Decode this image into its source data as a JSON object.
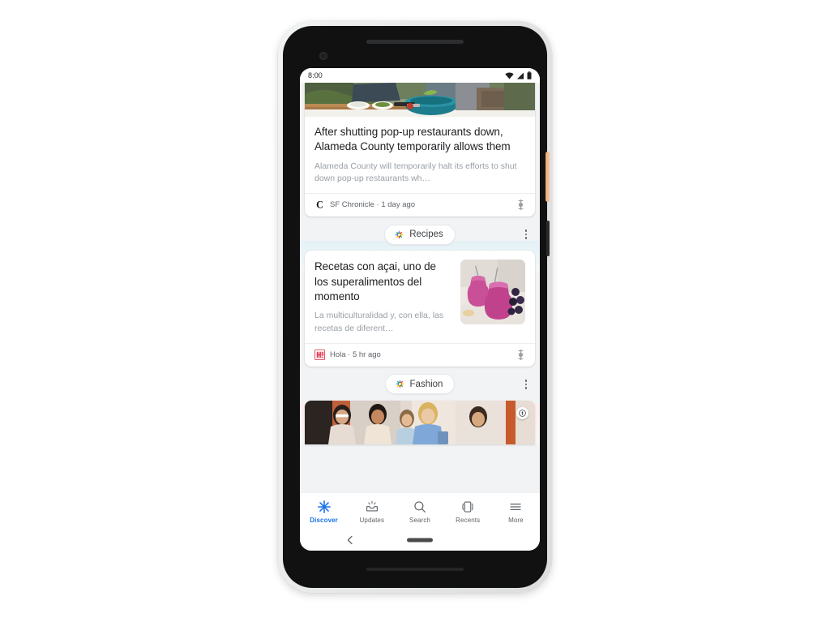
{
  "device": {
    "name": "pixel-phone",
    "power_button_color": "#e8a977",
    "frame_color": "#111112",
    "bezel_color": "#e9eaea"
  },
  "statusbar": {
    "time": "8:00",
    "icons": [
      "wifi-icon",
      "signal-icon",
      "battery-icon"
    ]
  },
  "feed": {
    "tint_blue": "#e4f1f6",
    "tint_pink": "#fdeef0",
    "accent_blue": "#1a73e8",
    "cards": [
      {
        "id": "news-card",
        "image_alt": "outdoor-cooking-scene",
        "headline": "After shutting pop-up restaurants down, Alameda County temporarily allows them",
        "snippet": "Alameda County will temporarily halt its efforts to shut down pop-up restaurants wh…",
        "source": "SF Chronicle · 1 day ago",
        "favicon": "sf-chronicle-favicon",
        "share_icon": "share-icon"
      },
      {
        "id": "recipes-card",
        "chip_label": "Recipes",
        "chip_icon": "discover-sparkle-icon",
        "kebab_icon": "more-options-icon",
        "headline": "Recetas con açai, uno de los superalimentos del momento",
        "snippet": "La multiculturalidad y, con ella, las recetas de diferent…",
        "source": "Hola · 5 hr ago",
        "favicon": "hola-favicon",
        "thumbnail_alt": "acai-smoothie-jars",
        "share_icon": "share-icon"
      },
      {
        "id": "fashion-card",
        "chip_label": "Fashion",
        "chip_icon": "discover-sparkle-icon",
        "kebab_icon": "more-options-icon",
        "image_alt": "fashion-people-carousel",
        "badge_icon": "video-badge-icon"
      }
    ]
  },
  "bottomnav": {
    "items": [
      {
        "label": "Discover",
        "icon": "discover-asterisk-icon",
        "active": true
      },
      {
        "label": "Updates",
        "icon": "updates-tray-icon",
        "active": false
      },
      {
        "label": "Search",
        "icon": "search-icon",
        "active": false
      },
      {
        "label": "Recents",
        "icon": "recents-cards-icon",
        "active": false
      },
      {
        "label": "More",
        "icon": "more-hamburger-icon",
        "active": false
      }
    ]
  },
  "androidnav": {
    "back_icon": "back-chevron-icon",
    "home_pill": "home-pill-indicator"
  }
}
